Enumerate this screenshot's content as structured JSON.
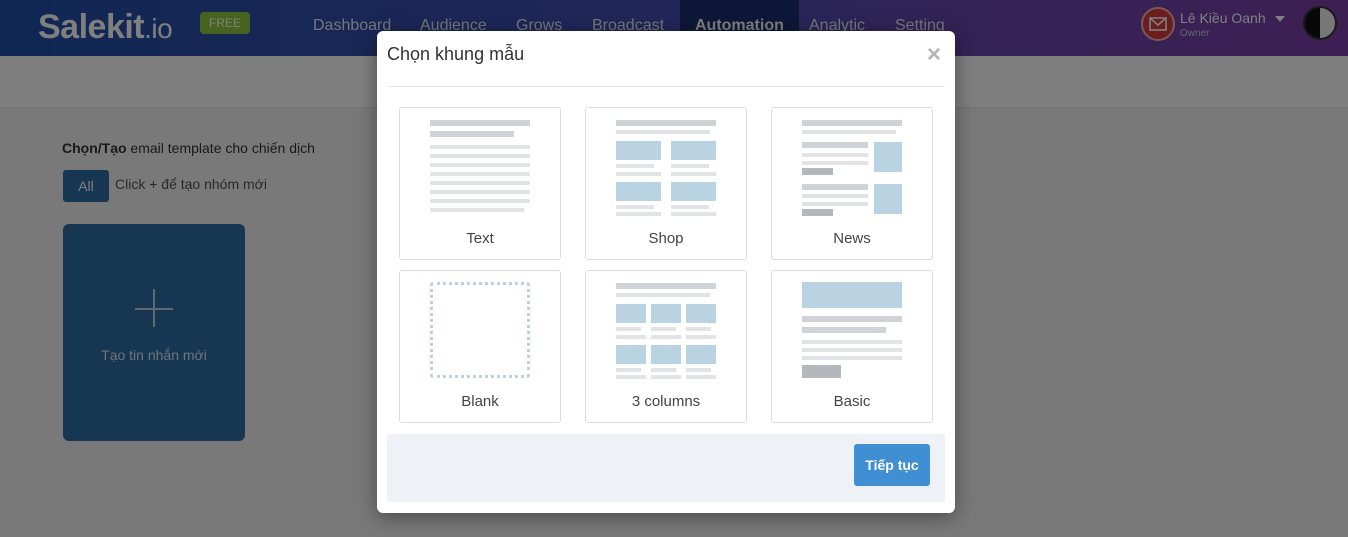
{
  "brand": {
    "logo_main": "Salekit",
    "logo_suffix": ".io",
    "plan_badge": "FREE"
  },
  "nav": {
    "items": [
      {
        "label": "Dashboard"
      },
      {
        "label": "Audience"
      },
      {
        "label": "Grows"
      },
      {
        "label": "Broadcast"
      },
      {
        "label": "Automation",
        "active": true
      },
      {
        "label": "Analytic"
      },
      {
        "label": "Setting"
      }
    ]
  },
  "user": {
    "name": "Lê Kiều Oanh",
    "role": "Owner",
    "avatar_icon": "mail-icon"
  },
  "page": {
    "heading_bold": "Chọn/Tạo",
    "heading_rest": " email template cho chiến dịch",
    "filter_all": "All",
    "hint": "Click + để tạo nhóm mới",
    "new_card_label": "Tạo tin nhắn mới"
  },
  "modal": {
    "title": "Chọn khung mẫu",
    "close_symbol": "×",
    "templates": [
      {
        "label": "Text"
      },
      {
        "label": "Shop"
      },
      {
        "label": "News"
      },
      {
        "label": "Blank"
      },
      {
        "label": "3 columns"
      },
      {
        "label": "Basic"
      }
    ],
    "next_button": "Tiếp tục"
  },
  "colors": {
    "nav_gradient_start": "#1f4fa8",
    "nav_gradient_end": "#7b3fa6",
    "primary_button": "#3f8fd2",
    "card_blue": "#2e6da4",
    "free_badge": "#8cc63f"
  }
}
